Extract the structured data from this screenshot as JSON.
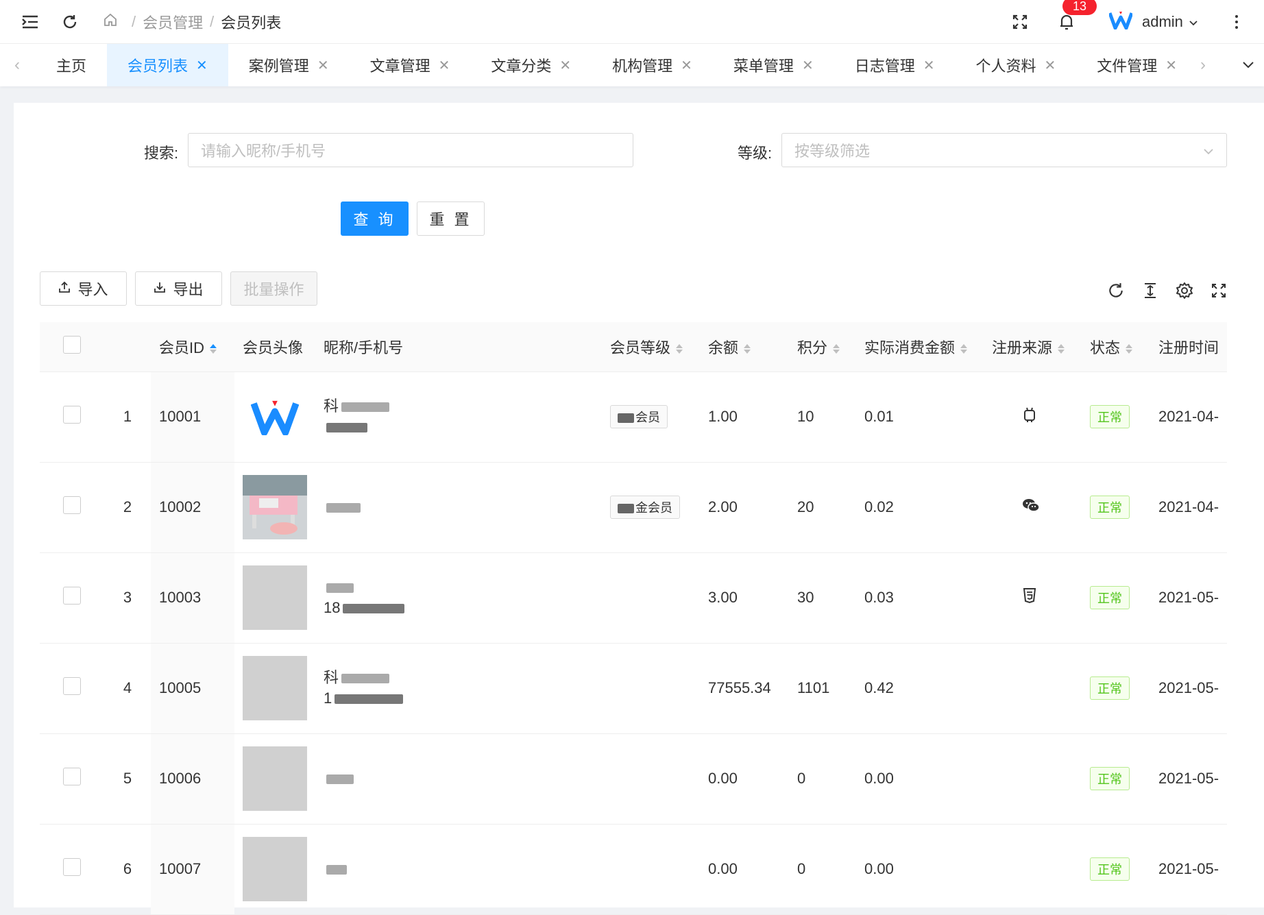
{
  "header": {
    "breadcrumb": [
      "会员管理",
      "会员列表"
    ],
    "breadcrumb_sep": "/",
    "notification_count": "13",
    "user_name": "admin"
  },
  "tabs": [
    {
      "label": "主页",
      "active": false,
      "closable": false
    },
    {
      "label": "会员列表",
      "active": true,
      "closable": true
    },
    {
      "label": "案例管理",
      "active": false,
      "closable": true
    },
    {
      "label": "文章管理",
      "active": false,
      "closable": true
    },
    {
      "label": "文章分类",
      "active": false,
      "closable": true
    },
    {
      "label": "机构管理",
      "active": false,
      "closable": true
    },
    {
      "label": "菜单管理",
      "active": false,
      "closable": true
    },
    {
      "label": "日志管理",
      "active": false,
      "closable": true
    },
    {
      "label": "个人资料",
      "active": false,
      "closable": true
    },
    {
      "label": "文件管理",
      "active": false,
      "closable": true
    }
  ],
  "filters": {
    "search_label": "搜索:",
    "search_placeholder": "请输入昵称/手机号",
    "level_label": "等级:",
    "level_placeholder": "按等级筛选",
    "query_label": "查 询",
    "reset_label": "重 置"
  },
  "toolbar": {
    "import_label": "导入",
    "export_label": "导出",
    "batch_label": "批量操作"
  },
  "table": {
    "columns": [
      "",
      "",
      "会员ID",
      "会员头像",
      "昵称/手机号",
      "会员等级",
      "余额",
      "积分",
      "实际消费金额",
      "注册来源",
      "状态",
      "注册时间"
    ],
    "rows": [
      {
        "index": "1",
        "id": "10001",
        "avatar": "logo",
        "nick": "科",
        "phone": "",
        "level": "会员",
        "balance": "1.00",
        "points": "10",
        "spent": "0.01",
        "source": "android",
        "status": "正常",
        "time": "2021-04-"
      },
      {
        "index": "2",
        "id": "10002",
        "avatar": "photo",
        "nick": "",
        "phone": "",
        "level": "金会员",
        "balance": "2.00",
        "points": "20",
        "spent": "0.02",
        "source": "wechat",
        "status": "正常",
        "time": "2021-04-"
      },
      {
        "index": "3",
        "id": "10003",
        "avatar": "none",
        "nick": "",
        "phone": "18",
        "level": "",
        "balance": "3.00",
        "points": "30",
        "spent": "0.03",
        "source": "html5",
        "status": "正常",
        "time": "2021-05-"
      },
      {
        "index": "4",
        "id": "10005",
        "avatar": "none",
        "nick": "科",
        "phone": "1",
        "level": "",
        "balance": "77555.34",
        "points": "1101",
        "spent": "0.42",
        "source": "",
        "status": "正常",
        "time": "2021-05-"
      },
      {
        "index": "5",
        "id": "10006",
        "avatar": "none",
        "nick": "",
        "phone": "",
        "level": "",
        "balance": "0.00",
        "points": "0",
        "spent": "0.00",
        "source": "",
        "status": "正常",
        "time": "2021-05-"
      },
      {
        "index": "6",
        "id": "10007",
        "avatar": "none",
        "nick": "",
        "phone": "",
        "level": "",
        "balance": "0.00",
        "points": "0",
        "spent": "0.00",
        "source": "",
        "status": "正常",
        "time": "2021-05-"
      }
    ]
  },
  "colors": {
    "primary": "#1890ff",
    "success": "#52c41a",
    "danger": "#f5222d"
  }
}
